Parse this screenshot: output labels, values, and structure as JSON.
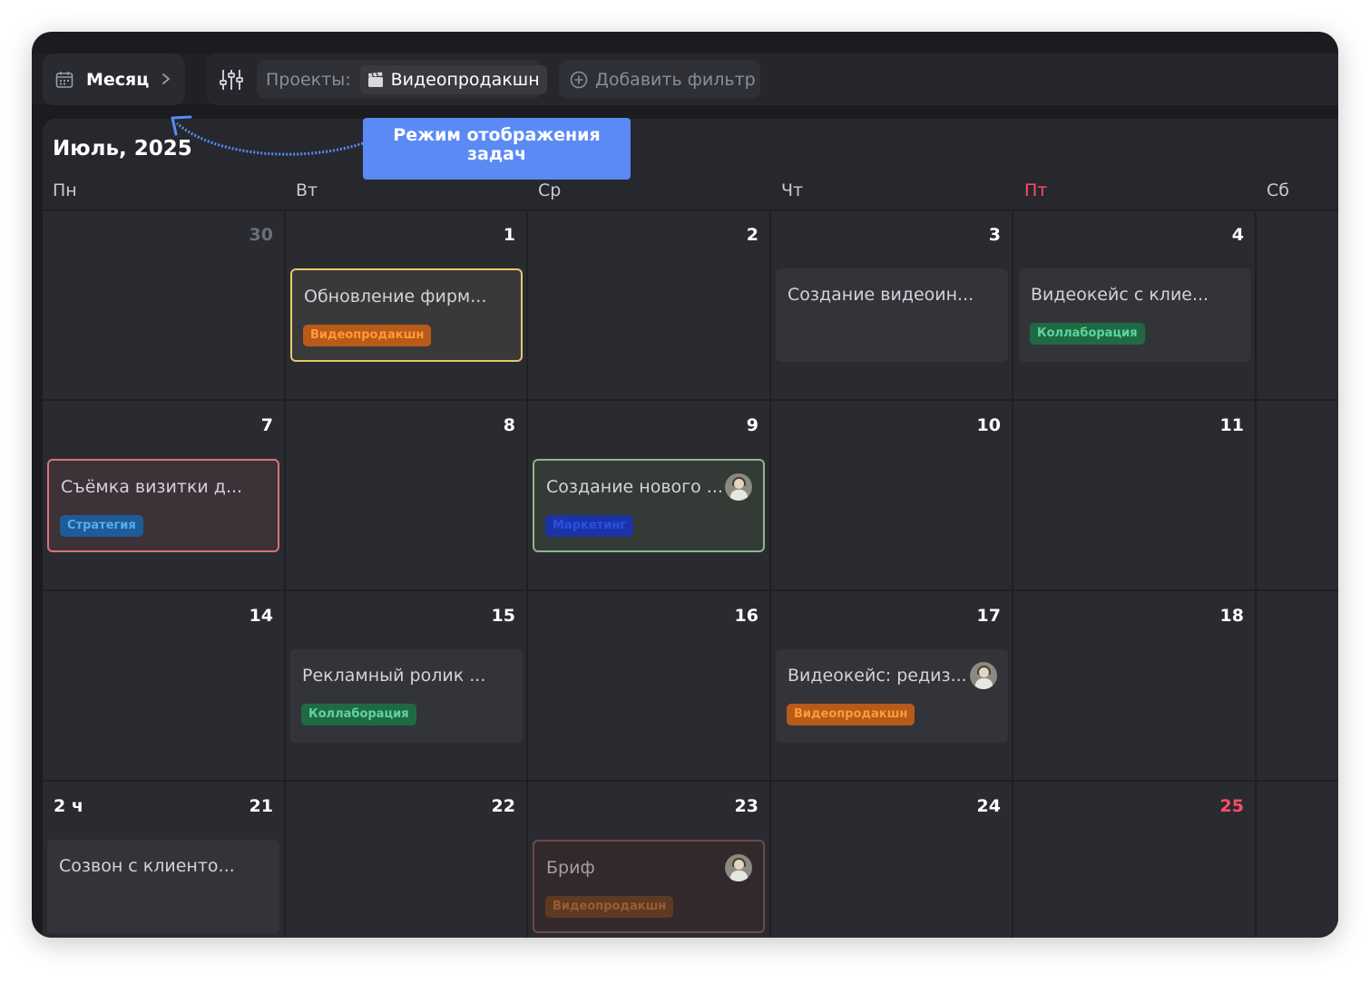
{
  "toolbar": {
    "view_mode_label": "Месяц",
    "projects_label": "Проекты:",
    "project_name": "Видеопродакшн",
    "add_filter_label": "Добавить фильтр"
  },
  "annotation": {
    "text_line1": "Режим отображения",
    "text_line2": "задач",
    "color": "#5b8af5"
  },
  "calendar": {
    "month_title": "Июль, 2025",
    "weekdays": [
      "Пн",
      "Вт",
      "Ср",
      "Чт",
      "Пт",
      "Сб"
    ],
    "weeks": [
      {
        "label": "",
        "days": [
          "30",
          "1",
          "2",
          "3",
          "4"
        ]
      },
      {
        "label": "",
        "days": [
          "7",
          "8",
          "9",
          "10",
          "11"
        ]
      },
      {
        "label": "",
        "days": [
          "14",
          "15",
          "16",
          "17",
          "18"
        ]
      },
      {
        "label": "2 ч",
        "days": [
          "21",
          "22",
          "23",
          "24",
          "25"
        ]
      }
    ],
    "events": [
      {
        "title": "Обновление фирм...",
        "tag": "Видеопродакшн"
      },
      {
        "title": "Создание видеоин..."
      },
      {
        "title": "Видеокейс с клие...",
        "tag": "Коллаборация"
      },
      {
        "title": "Съёмка визитки д...",
        "tag": "Стратегия"
      },
      {
        "title": "Создание нового ...",
        "tag": "Маркетинг"
      },
      {
        "title": "Рекламный ролик ...",
        "tag": "Коллаборация"
      },
      {
        "title": "Видеокейс: редиз...",
        "tag": "Видеопродакшн"
      },
      {
        "title": "Созвон с клиенто..."
      },
      {
        "title": "Бриф",
        "tag": "Видеопродакшн"
      }
    ]
  },
  "colors": {
    "accent_red": "#ff4d6a",
    "tag_orange": "#ff9a3a",
    "tag_green": "#5fd59a",
    "tag_blue": "#52aef5"
  }
}
